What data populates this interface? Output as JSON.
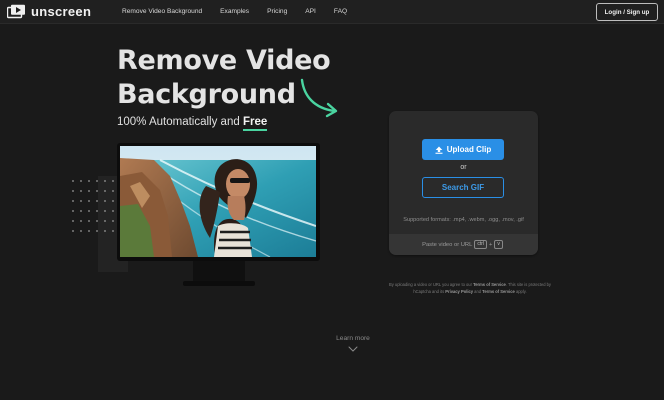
{
  "header": {
    "logo_text": "unscreen",
    "nav": [
      "Remove Video Background",
      "Examples",
      "Pricing",
      "API",
      "FAQ"
    ],
    "login_label": "Login / Sign up"
  },
  "hero": {
    "title_line1": "Remove Video",
    "title_line2": "Background",
    "subtitle_prefix": "100% Automatically and ",
    "subtitle_free": "Free"
  },
  "upload": {
    "upload_label": "Upload Clip",
    "or_label": "or",
    "search_label": "Search GIF",
    "formats": "Supported formats: .mp4, .webm, .ogg, .mov, .gif",
    "paste_label": "Paste video or URL",
    "key_ctrl": "ctrl",
    "key_plus": "+",
    "key_v": "v"
  },
  "terms": {
    "part1": "By uploading a video or URL you agree to our ",
    "terms_link": "Terms of Service",
    "part2": ". This site is protected by hCaptcha and its ",
    "privacy_link": "Privacy Policy",
    "part3": " and ",
    "terms_link2": "Terms of Service",
    "part4": " apply."
  },
  "learn_more": "Learn more",
  "colors": {
    "background": "#1a1a1a",
    "header": "#202020",
    "accent_blue": "#2a8fe6",
    "accent_green": "#4ad4a0",
    "panel": "#2a2a2a"
  },
  "icons": [
    "logo-play-icon",
    "upload-arrow-icon",
    "curved-arrow-icon",
    "chevron-down-icon"
  ]
}
